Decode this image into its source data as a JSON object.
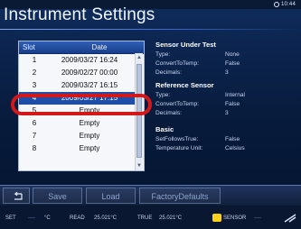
{
  "header": {
    "title": "Instrument Settings",
    "time": "10:44"
  },
  "list": {
    "columns": {
      "slot": "Slot",
      "date": "Date"
    },
    "rows": [
      {
        "slot": "1",
        "date": "2009/03/27 16:24",
        "selected": false
      },
      {
        "slot": "2",
        "date": "2009/02/27 00:00",
        "selected": false
      },
      {
        "slot": "3",
        "date": "2009/03/27 16:15",
        "selected": false
      },
      {
        "slot": "4",
        "date": "2009/03/27 17:15",
        "selected": true
      },
      {
        "slot": "5",
        "date": "Empty",
        "selected": false
      },
      {
        "slot": "6",
        "date": "Empty",
        "selected": false
      },
      {
        "slot": "7",
        "date": "Empty",
        "selected": false
      },
      {
        "slot": "8",
        "date": "Empty",
        "selected": false
      }
    ]
  },
  "details": {
    "sensor_under_test": {
      "title": "Sensor Under Test",
      "fields": [
        {
          "label": "Type:",
          "value": "None"
        },
        {
          "label": "ConvertToTemp:",
          "value": "False"
        },
        {
          "label": "Decimals:",
          "value": "3"
        }
      ]
    },
    "reference_sensor": {
      "title": "Reference Sensor",
      "fields": [
        {
          "label": "Type:",
          "value": "Internal"
        },
        {
          "label": "ConvertToTemp:",
          "value": "False"
        },
        {
          "label": "Decimals:",
          "value": "3"
        }
      ]
    },
    "basic": {
      "title": "Basic",
      "fields": [
        {
          "label": "SetFollowsTrue:",
          "value": "False"
        },
        {
          "label": "Temperature Unit:",
          "value": "Celsius"
        }
      ]
    }
  },
  "buttons": {
    "save": "Save",
    "load": "Load",
    "factory_defaults": "FactoryDefaults"
  },
  "status": {
    "set_label": "SET",
    "set_value": "----",
    "set_unit": "°C",
    "read_label": "READ",
    "read_value": "25.021°C",
    "true_label": "TRUE",
    "true_value": "25.021°C",
    "sensor_label": "SENSOR",
    "sensor_value": "----"
  },
  "colors": {
    "accent": "#1f4ea8",
    "highlight_ring": "#d21818",
    "status_indicator": "#ffd21a"
  },
  "icons": {
    "clock": "clock-icon",
    "back": "back-arrow-icon",
    "scroll_up": "chevron-up-icon",
    "scroll_down": "chevron-down-icon",
    "signal": "signal-icon"
  }
}
